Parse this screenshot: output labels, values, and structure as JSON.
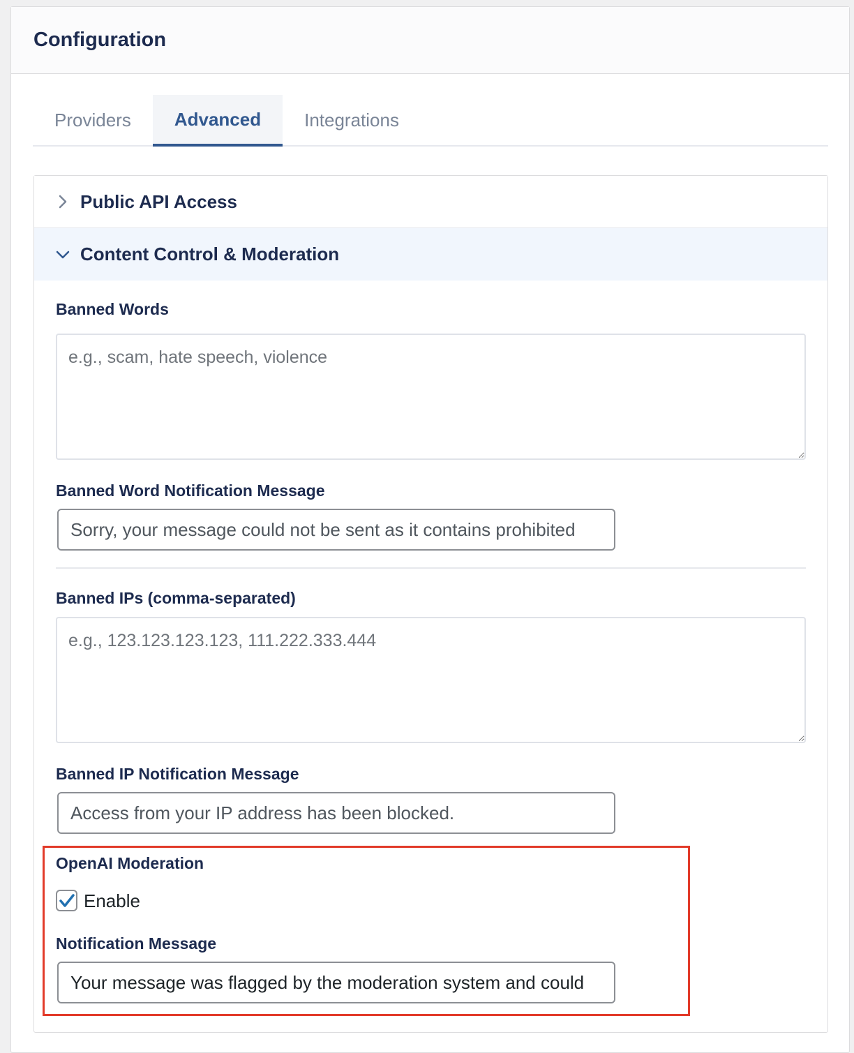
{
  "header": {
    "title": "Configuration"
  },
  "tabs": [
    {
      "label": "Providers",
      "active": false
    },
    {
      "label": "Advanced",
      "active": true
    },
    {
      "label": "Integrations",
      "active": false
    }
  ],
  "sections": {
    "public_api": {
      "title": "Public API Access",
      "expanded": false,
      "icon": "chevron-right-icon"
    },
    "content_control": {
      "title": "Content Control & Moderation",
      "expanded": true,
      "icon": "chevron-down-icon"
    }
  },
  "fields": {
    "banned_words": {
      "label": "Banned Words",
      "placeholder": "e.g., scam, hate speech, violence",
      "value": ""
    },
    "banned_word_message": {
      "label": "Banned Word Notification Message",
      "value": "Sorry, your message could not be sent as it contains prohibited"
    },
    "banned_ips": {
      "label": "Banned IPs (comma-separated)",
      "placeholder": "e.g., 123.123.123.123, 111.222.333.444",
      "value": ""
    },
    "banned_ip_message": {
      "label": "Banned IP Notification Message",
      "value": "Access from your IP address has been blocked."
    },
    "openai_moderation": {
      "label": "OpenAI Moderation",
      "enable_label": "Enable",
      "enabled": true
    },
    "notification_message": {
      "label": "Notification Message",
      "value": "Your message was flagged by the moderation system and could"
    }
  },
  "colors": {
    "accent": "#31588f",
    "checkmark": "#2271b1",
    "highlight_border": "#e23b2a",
    "heading": "#1d2b4f"
  }
}
